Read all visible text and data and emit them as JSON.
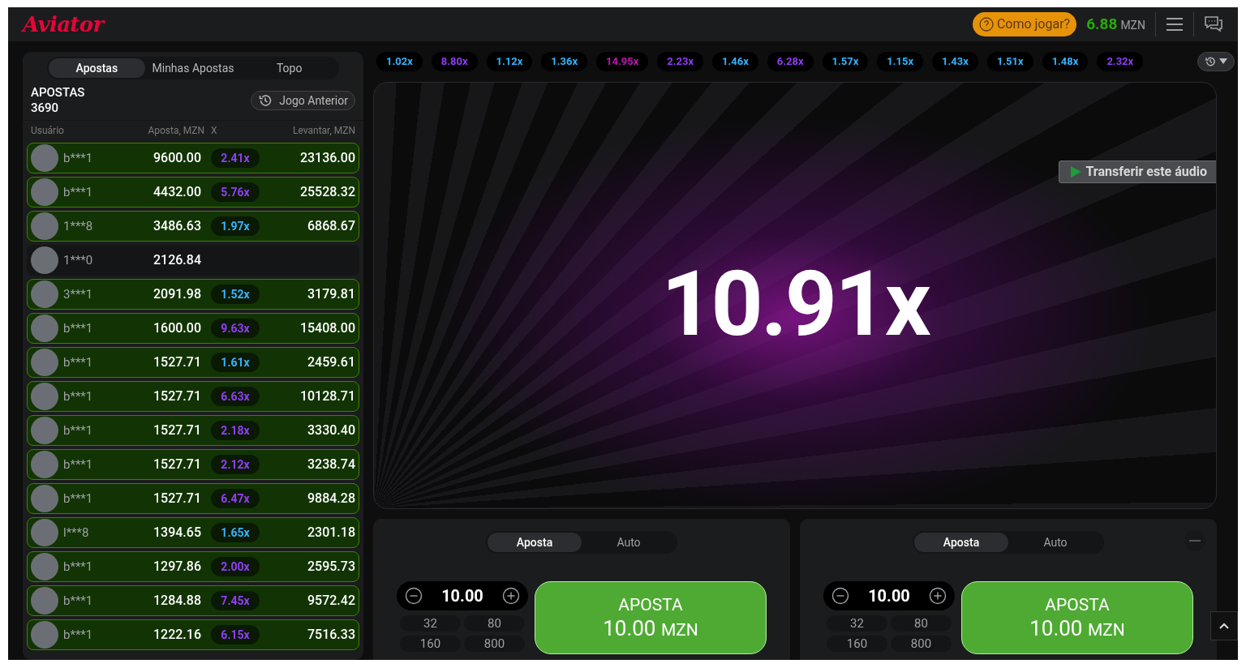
{
  "header": {
    "logo": "Aviator",
    "help_button": "Como jogar?",
    "balance": "6.88",
    "currency": "MZN"
  },
  "bets_panel": {
    "tabs": [
      {
        "label": "Apostas",
        "selected": true
      },
      {
        "label": "Minhas Apostas",
        "selected": false
      },
      {
        "label": "Topo",
        "selected": false
      }
    ],
    "title": "APOSTAS",
    "count": "3690",
    "previous_button": "Jogo Anterior",
    "columns": [
      "Usuário",
      "Aposta, MZN",
      "X",
      "Levantar, MZN"
    ],
    "rows": [
      {
        "user": "b***1",
        "bet": "9600.00",
        "won": true,
        "multiplier": "2.41x",
        "color": "#913ef8",
        "payout": "23136.00"
      },
      {
        "user": "b***1",
        "bet": "4432.00",
        "won": true,
        "multiplier": "5.76x",
        "color": "#913ef8",
        "payout": "25528.32"
      },
      {
        "user": "1***8",
        "bet": "3486.63",
        "won": true,
        "multiplier": "1.97x",
        "color": "#34b4ff",
        "payout": "6868.67"
      },
      {
        "user": "1***0",
        "bet": "2126.84",
        "won": false
      },
      {
        "user": "3***1",
        "bet": "2091.98",
        "won": true,
        "multiplier": "1.52x",
        "color": "#34b4ff",
        "payout": "3179.81"
      },
      {
        "user": "b***1",
        "bet": "1600.00",
        "won": true,
        "multiplier": "9.63x",
        "color": "#913ef8",
        "payout": "15408.00"
      },
      {
        "user": "b***1",
        "bet": "1527.71",
        "won": true,
        "multiplier": "1.61x",
        "color": "#34b4ff",
        "payout": "2459.61"
      },
      {
        "user": "b***1",
        "bet": "1527.71",
        "won": true,
        "multiplier": "6.63x",
        "color": "#913ef8",
        "payout": "10128.71"
      },
      {
        "user": "b***1",
        "bet": "1527.71",
        "won": true,
        "multiplier": "2.18x",
        "color": "#913ef8",
        "payout": "3330.40"
      },
      {
        "user": "b***1",
        "bet": "1527.71",
        "won": true,
        "multiplier": "2.12x",
        "color": "#913ef8",
        "payout": "3238.74"
      },
      {
        "user": "b***1",
        "bet": "1527.71",
        "won": true,
        "multiplier": "6.47x",
        "color": "#913ef8",
        "payout": "9884.28"
      },
      {
        "user": "l***8",
        "bet": "1394.65",
        "won": true,
        "multiplier": "1.65x",
        "color": "#34b4ff",
        "payout": "2301.18"
      },
      {
        "user": "b***1",
        "bet": "1297.86",
        "won": true,
        "multiplier": "2.00x",
        "color": "#913ef8",
        "payout": "2595.73"
      },
      {
        "user": "b***1",
        "bet": "1284.88",
        "won": true,
        "multiplier": "7.45x",
        "color": "#913ef8",
        "payout": "9572.42"
      },
      {
        "user": "b***1",
        "bet": "1222.16",
        "won": true,
        "multiplier": "6.15x",
        "color": "#913ef8",
        "payout": "7516.33"
      }
    ]
  },
  "history": [
    {
      "value": "1.02x",
      "color": "#34b4ff"
    },
    {
      "value": "8.80x",
      "color": "#913ef8"
    },
    {
      "value": "1.12x",
      "color": "#34b4ff"
    },
    {
      "value": "1.36x",
      "color": "#34b4ff"
    },
    {
      "value": "14.95x",
      "color": "#c017b4"
    },
    {
      "value": "2.23x",
      "color": "#913ef8"
    },
    {
      "value": "1.46x",
      "color": "#34b4ff"
    },
    {
      "value": "6.28x",
      "color": "#913ef8"
    },
    {
      "value": "1.57x",
      "color": "#34b4ff"
    },
    {
      "value": "1.15x",
      "color": "#34b4ff"
    },
    {
      "value": "1.43x",
      "color": "#34b4ff"
    },
    {
      "value": "1.51x",
      "color": "#34b4ff"
    },
    {
      "value": "1.48x",
      "color": "#34b4ff"
    },
    {
      "value": "2.32x",
      "color": "#913ef8"
    }
  ],
  "game": {
    "multiplier": "10.91x",
    "audio_button": "Transferir este áudio"
  },
  "bet_controls": [
    {
      "tabs": [
        {
          "label": "Aposta",
          "selected": true
        },
        {
          "label": "Auto",
          "selected": false
        }
      ],
      "amount": "10.00",
      "quick_amounts": [
        "32",
        "80",
        "160",
        "800"
      ],
      "button_label": "APOSTA",
      "button_amount": "10.00",
      "button_currency": "MZN",
      "removable": false
    },
    {
      "tabs": [
        {
          "label": "Aposta",
          "selected": true
        },
        {
          "label": "Auto",
          "selected": false
        }
      ],
      "amount": "10.00",
      "quick_amounts": [
        "32",
        "80",
        "160",
        "800"
      ],
      "button_label": "APOSTA",
      "button_amount": "10.00",
      "button_currency": "MZN",
      "removable": true
    }
  ]
}
